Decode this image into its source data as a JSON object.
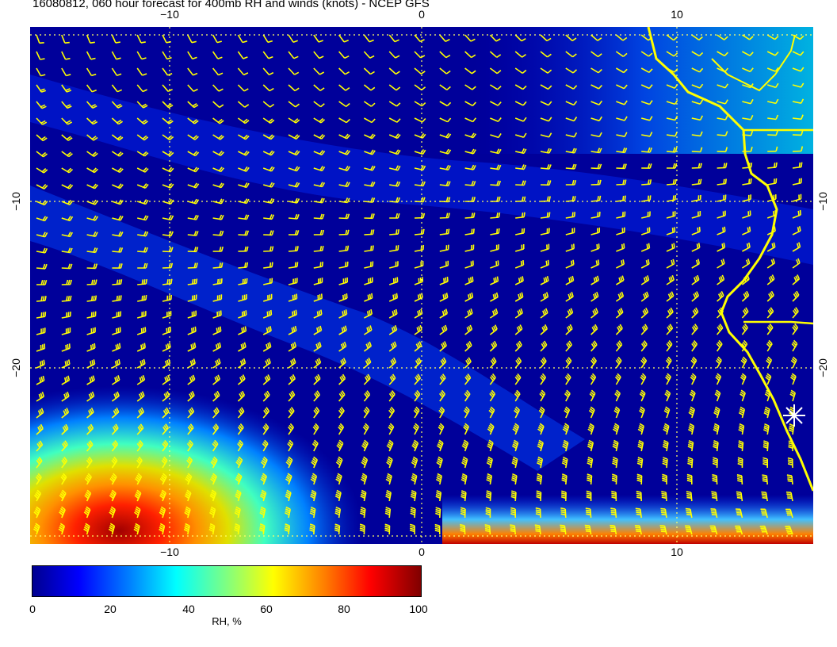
{
  "title": "16080812, 060 hour forecast for 400mb RH and winds (knots) - NCEP GFS",
  "axes": {
    "top_ticks": [
      "−10",
      "0",
      "10"
    ],
    "bottom_ticks": [
      "−10",
      "0",
      "10"
    ],
    "left_ticks": [
      "−10",
      "−20"
    ],
    "right_ticks": [
      "−10",
      "−20"
    ]
  },
  "colorbar": {
    "label": "RH, %",
    "ticks": [
      "0",
      "20",
      "40",
      "60",
      "80",
      "100"
    ]
  },
  "colors": {
    "background_ocean": "#00008f",
    "wind_barbs": "#ffff00",
    "coastline": "#ffff00",
    "gridlines": "#ffff66"
  },
  "marker": {
    "icon": "asterisk-station-icon"
  }
}
